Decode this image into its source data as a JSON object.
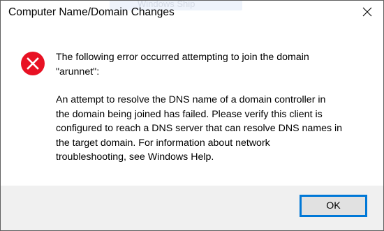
{
  "window": {
    "title": "Computer Name/Domain Changes",
    "background_hint": "Windows Ship"
  },
  "icons": {
    "close": "close-icon",
    "error": "error-icon"
  },
  "message": {
    "heading_line1": "The following error occurred attempting to join the domain",
    "heading_line2": "\"arunnet\":",
    "body_line1": "An attempt to resolve the DNS name of a domain controller in",
    "body_line2": "the domain being joined has failed.  Please verify this client is",
    "body_line3": "configured to reach a DNS server that can resolve DNS names in",
    "body_line4": "the target domain. For information about network",
    "body_line5": "troubleshooting, see Windows Help."
  },
  "buttons": {
    "ok_label": "OK"
  },
  "colors": {
    "error_red": "#e81123",
    "accent_blue": "#0078d7",
    "footer_gray": "#f0f0f0"
  }
}
